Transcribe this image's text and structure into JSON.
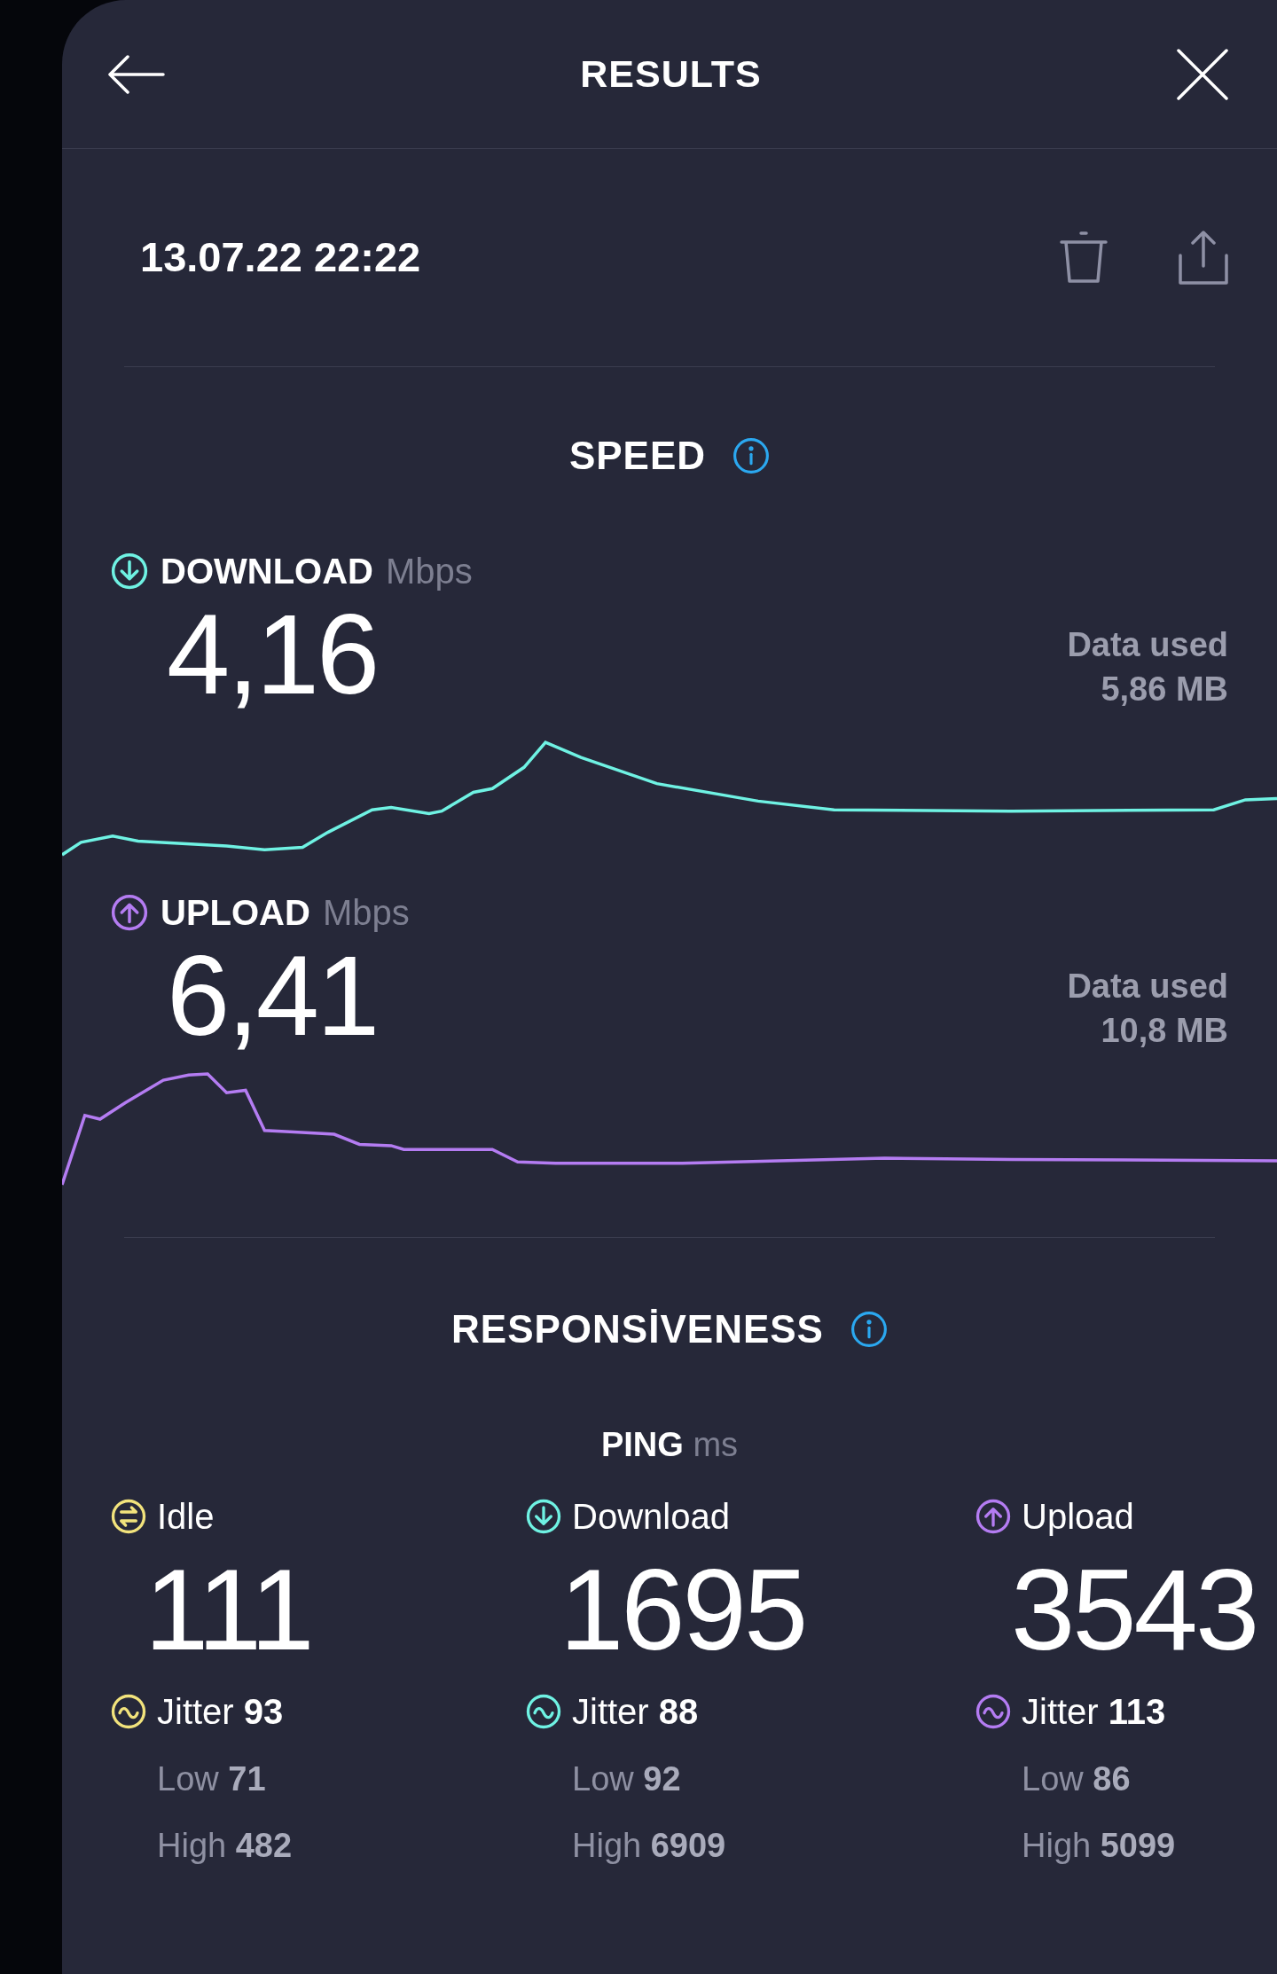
{
  "header": {
    "title": "RESULTS"
  },
  "date": "13.07.22 22:22",
  "speed": {
    "title": "SPEED",
    "metrics": [
      {
        "kind": "download",
        "label": "DOWNLOAD",
        "unit": "Mbps",
        "value": "4,16",
        "data_used_label": "Data used",
        "data_used": "5,86 MB"
      },
      {
        "kind": "upload",
        "label": "UPLOAD",
        "unit": "Mbps",
        "value": "6,41",
        "data_used_label": "Data used",
        "data_used": "10,8 MB"
      }
    ]
  },
  "responsiveness": {
    "title": "RESPONSİVENESS",
    "ping": {
      "label": "PING",
      "unit": "ms",
      "columns": [
        {
          "kind": "idle",
          "label": "Idle",
          "value": "111",
          "jitter": "Jitter **93**",
          "low": "Low **71**",
          "high": "High **482**"
        },
        {
          "kind": "download",
          "label": "Download",
          "value": "1695",
          "jitter": "Jitter **88**",
          "low": "Low **92**",
          "high": "High **6909**"
        },
        {
          "kind": "upload",
          "label": "Upload",
          "value": "3543",
          "jitter": "Jitter **113**",
          "low": "Low **86**",
          "high": "High **5099**"
        }
      ]
    }
  }
}
